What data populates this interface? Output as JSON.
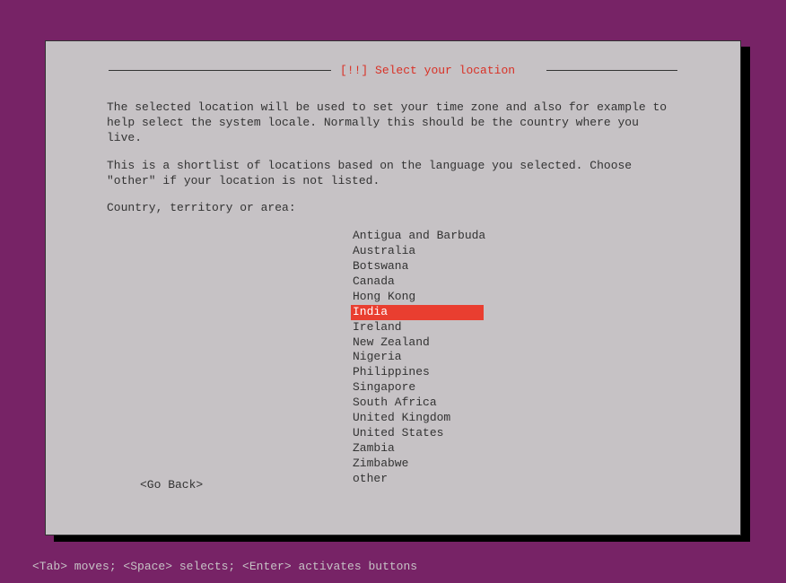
{
  "dialog": {
    "title_prefix": "[!!]",
    "title": "Select your location",
    "paragraph1": "The selected location will be used to set your time zone and also for example to help select the system locale. Normally this should be the country where you live.",
    "paragraph2": "This is a shortlist of locations based on the language you selected. Choose \"other\" if your location is not listed.",
    "prompt": "Country, territory or area:",
    "items": [
      "Antigua and Barbuda",
      "Australia",
      "Botswana",
      "Canada",
      "Hong Kong",
      "India",
      "Ireland",
      "New Zealand",
      "Nigeria",
      "Philippines",
      "Singapore",
      "South Africa",
      "United Kingdom",
      "United States",
      "Zambia",
      "Zimbabwe",
      "other"
    ],
    "selected_index": 5,
    "go_back": "<Go Back>"
  },
  "hint": "<Tab> moves; <Space> selects; <Enter> activates buttons"
}
